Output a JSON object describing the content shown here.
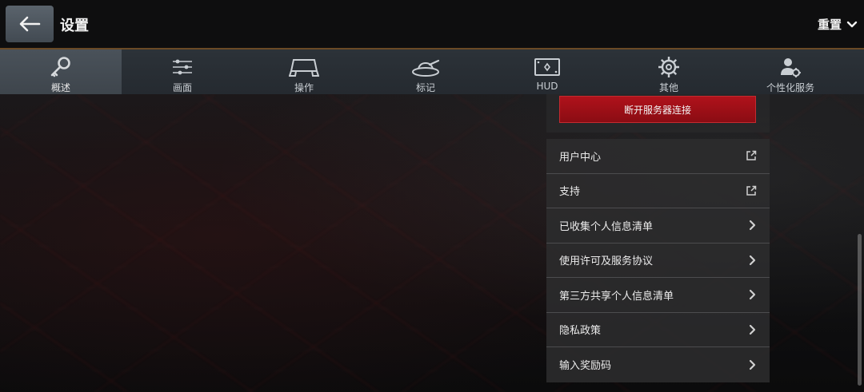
{
  "header": {
    "title": "设置",
    "reset_label": "重置",
    "back_icon": "back-arrow-icon",
    "accent_line": "#6a4a26"
  },
  "tabs": [
    {
      "label": "概述",
      "icon": "key-icon",
      "active": true
    },
    {
      "label": "画面",
      "icon": "sliders-icon",
      "active": false
    },
    {
      "label": "操作",
      "icon": "controls-icon",
      "active": false
    },
    {
      "label": "标记",
      "icon": "tank-icon",
      "active": false
    },
    {
      "label": "HUD",
      "icon": "hud-icon",
      "active": false
    },
    {
      "label": "其他",
      "icon": "gear-icon",
      "active": false
    },
    {
      "label": "个性化服务",
      "icon": "user-gear-icon",
      "active": false
    }
  ],
  "panel": {
    "disconnect_label": "断开服务器连接",
    "disconnect_color": "#a0101a",
    "menu": [
      {
        "label": "用户中心",
        "icon": "external-link-icon"
      },
      {
        "label": "支持",
        "icon": "external-link-icon"
      },
      {
        "label": "已收集个人信息清单",
        "icon": "chevron-right-icon"
      },
      {
        "label": "使用许可及服务协议",
        "icon": "chevron-right-icon"
      },
      {
        "label": "第三方共享个人信息清单",
        "icon": "chevron-right-icon"
      },
      {
        "label": "隐私政策",
        "icon": "chevron-right-icon"
      },
      {
        "label": "输入奖励码",
        "icon": "chevron-right-icon"
      }
    ]
  }
}
